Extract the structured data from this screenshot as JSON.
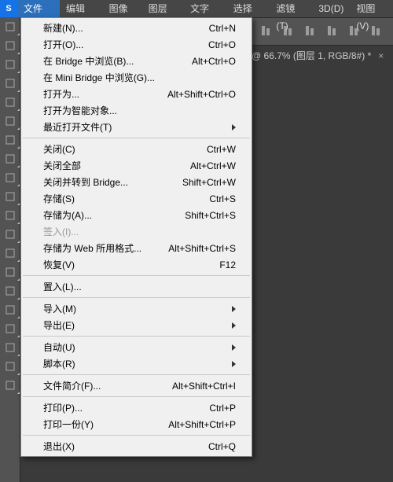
{
  "logo": "S",
  "menu_bar": {
    "items": [
      {
        "label": "文件(F)",
        "active": true
      },
      {
        "label": "编辑(E)"
      },
      {
        "label": "图像(I)"
      },
      {
        "label": "图层(L)"
      },
      {
        "label": "文字(Y)"
      },
      {
        "label": "选择(S)"
      },
      {
        "label": "滤镜(T)"
      },
      {
        "label": "3D(D)"
      },
      {
        "label": "视图(V)"
      }
    ]
  },
  "doc_tab": {
    "label": "@ 66.7% (图层 1, RGB/8#) *"
  },
  "file_menu": [
    {
      "label": "新建(N)...",
      "shortcut": "Ctrl+N"
    },
    {
      "label": "打开(O)...",
      "shortcut": "Ctrl+O"
    },
    {
      "label": "在 Bridge 中浏览(B)...",
      "shortcut": "Alt+Ctrl+O"
    },
    {
      "label": "在 Mini Bridge 中浏览(G)..."
    },
    {
      "label": "打开为...",
      "shortcut": "Alt+Shift+Ctrl+O"
    },
    {
      "label": "打开为智能对象..."
    },
    {
      "label": "最近打开文件(T)",
      "submenu": true
    },
    {
      "sep": true
    },
    {
      "label": "关闭(C)",
      "shortcut": "Ctrl+W"
    },
    {
      "label": "关闭全部",
      "shortcut": "Alt+Ctrl+W"
    },
    {
      "label": "关闭并转到 Bridge...",
      "shortcut": "Shift+Ctrl+W"
    },
    {
      "label": "存储(S)",
      "shortcut": "Ctrl+S"
    },
    {
      "label": "存储为(A)...",
      "shortcut": "Shift+Ctrl+S"
    },
    {
      "label": "签入(I)...",
      "disabled": true
    },
    {
      "label": "存储为 Web 所用格式...",
      "shortcut": "Alt+Shift+Ctrl+S"
    },
    {
      "label": "恢复(V)",
      "shortcut": "F12"
    },
    {
      "sep": true
    },
    {
      "label": "置入(L)..."
    },
    {
      "sep": true
    },
    {
      "label": "导入(M)",
      "submenu": true
    },
    {
      "label": "导出(E)",
      "submenu": true
    },
    {
      "sep": true
    },
    {
      "label": "自动(U)",
      "submenu": true
    },
    {
      "label": "脚本(R)",
      "submenu": true
    },
    {
      "sep": true
    },
    {
      "label": "文件简介(F)...",
      "shortcut": "Alt+Shift+Ctrl+I"
    },
    {
      "sep": true
    },
    {
      "label": "打印(P)...",
      "shortcut": "Ctrl+P"
    },
    {
      "label": "打印一份(Y)",
      "shortcut": "Alt+Shift+Ctrl+P"
    },
    {
      "sep": true
    },
    {
      "label": "退出(X)",
      "shortcut": "Ctrl+Q"
    }
  ],
  "left_tools": [
    {
      "name": "move-tool-icon"
    },
    {
      "name": "marquee-tool-icon"
    },
    {
      "name": "lasso-tool-icon"
    },
    {
      "name": "wand-tool-icon"
    },
    {
      "name": "crop-tool-icon"
    },
    {
      "name": "eyedropper-tool-icon"
    },
    {
      "name": "heal-tool-icon"
    },
    {
      "name": "brush-tool-icon"
    },
    {
      "name": "stamp-tool-icon"
    },
    {
      "name": "history-brush-tool-icon"
    },
    {
      "name": "eraser-tool-icon"
    },
    {
      "name": "gradient-tool-icon"
    },
    {
      "name": "blur-tool-icon"
    },
    {
      "name": "dodge-tool-icon"
    },
    {
      "name": "pen-tool-icon"
    },
    {
      "name": "type-tool-icon"
    },
    {
      "name": "path-tool-icon"
    },
    {
      "name": "shape-tool-icon"
    },
    {
      "name": "hand-tool-icon"
    },
    {
      "name": "zoom-tool-icon"
    }
  ],
  "toolbar_icons": [
    {
      "name": "align-left-icon"
    },
    {
      "name": "align-center-h-icon"
    },
    {
      "name": "align-right-icon"
    },
    {
      "name": "align-top-icon"
    },
    {
      "name": "align-center-v-icon"
    },
    {
      "name": "align-bottom-icon"
    }
  ]
}
